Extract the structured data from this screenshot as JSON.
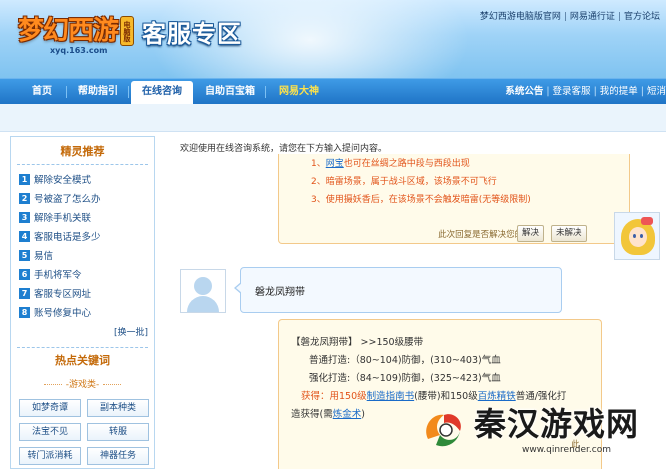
{
  "header": {
    "logo_text": "梦幻西游",
    "logo_badge": "电脑版",
    "logo_url": "xyq.163.com",
    "section_title": "客服专区",
    "top_links": [
      "梦幻西游电脑版官网",
      "网易通行证",
      "官方论坛"
    ]
  },
  "nav": {
    "items": [
      {
        "label": "首页"
      },
      {
        "label": "帮助指引"
      },
      {
        "label": "在线咨询"
      },
      {
        "label": "自助百宝箱"
      },
      {
        "label": "网易大神"
      }
    ],
    "right_links": [
      "系统公告",
      "登录客服",
      "我的提单",
      "短消"
    ]
  },
  "sidebar": {
    "title1": "精灵推荐",
    "items": [
      {
        "num": "1",
        "label": "解除安全模式"
      },
      {
        "num": "2",
        "label": "号被盗了怎么办"
      },
      {
        "num": "3",
        "label": "解除手机关联"
      },
      {
        "num": "4",
        "label": "客服电话是多少"
      },
      {
        "num": "5",
        "label": "易信"
      },
      {
        "num": "6",
        "label": "手机将军令"
      },
      {
        "num": "7",
        "label": "客服专区网址"
      },
      {
        "num": "8",
        "label": "账号修复中心"
      }
    ],
    "switch_label": "[换一批]",
    "title2": "热点关键词",
    "category": "-游戏类-",
    "keywords": [
      "如梦奇谭",
      "副本种类",
      "法宝不见",
      "转服",
      "转门派消耗",
      "神器任务"
    ]
  },
  "main": {
    "welcome": "欢迎使用在线咨询系统，请您在下方输入提问内容。",
    "reply1": {
      "line1_pre": "1、",
      "line1_link": "网宝",
      "line1_post": "也可在丝绸之路中段与西段出现",
      "line2": "2、暗雷场景，属于战斗区域，该场景不可飞行",
      "line3": "3、使用摄妖香后，在该场景不会触发暗雷(无等级限制)",
      "ask": "此次回复是否解决您的疑问:",
      "btn_yes": "解决",
      "btn_no": "未解决"
    },
    "user_msg": "磐龙凤翔带",
    "reply2": {
      "title": "【磐龙凤翔带】  >>150级腰带",
      "normal": "普通打造:（80~104)防御，(310~403)气血",
      "strong": "强化打造:（84~109)防御，(325~423)气血",
      "get_pre": "获得：用150级",
      "get_link1": "制造指南书",
      "get_mid": "(腰带)和150级",
      "get_link2": "百炼精铁",
      "get_post": "普通/强化打",
      "line5_pre": "造获得(需",
      "line5_link": "炼金术",
      "line5_post": ")",
      "ask_partial": "此"
    }
  },
  "watermark": {
    "text": "秦汉游戏网",
    "url": "www.qinrender.com"
  }
}
